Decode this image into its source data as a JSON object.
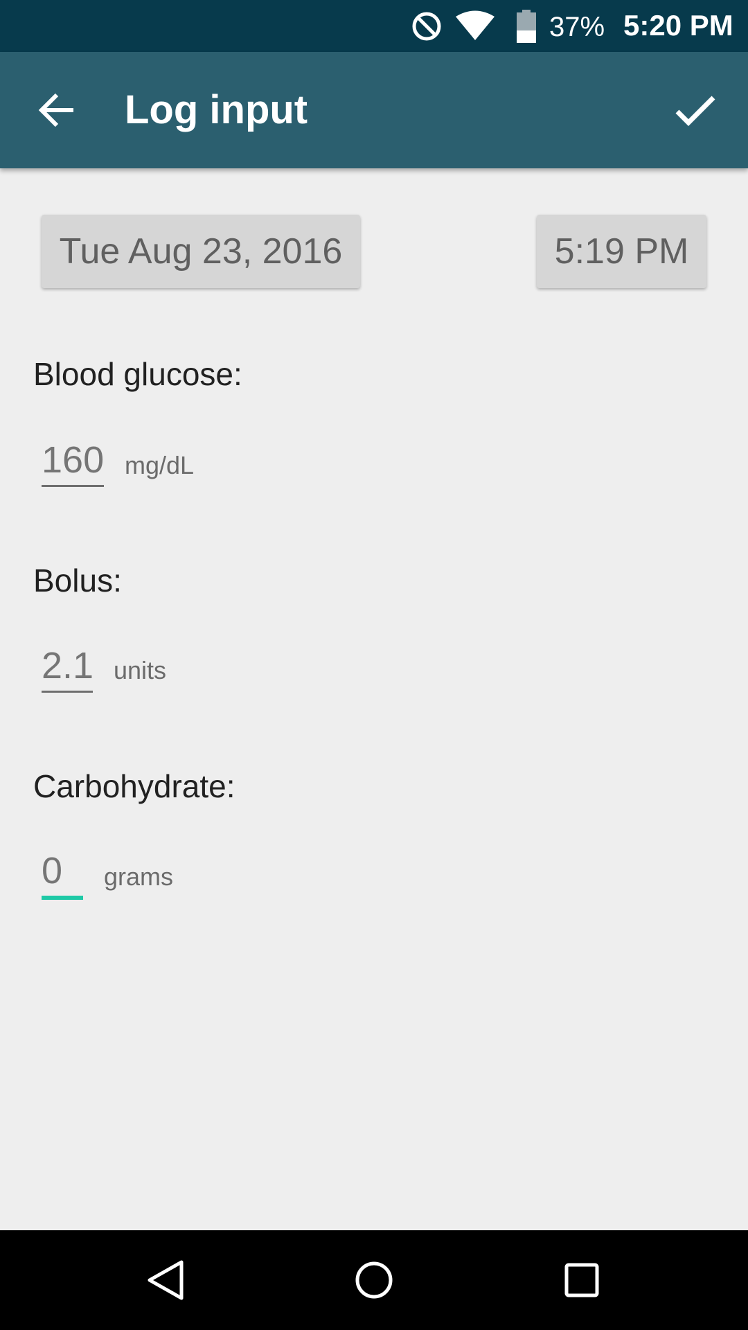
{
  "status_bar": {
    "battery_percent": "37%",
    "time": "5:20 PM",
    "icons": [
      "do-not-disturb-icon",
      "wifi-icon",
      "battery-icon"
    ]
  },
  "app_bar": {
    "title": "Log input",
    "back_icon": "arrow-back-icon",
    "confirm_icon": "checkmark-icon",
    "background_color": "#2b5f6f"
  },
  "datetime": {
    "date": "Tue Aug 23, 2016",
    "time": "5:19 PM"
  },
  "fields": {
    "blood_glucose": {
      "label": "Blood glucose:",
      "value": "160",
      "unit": "mg/dL"
    },
    "bolus": {
      "label": "Bolus:",
      "value": "2.1",
      "unit": "units"
    },
    "carbohydrate": {
      "label": "Carbohydrate:",
      "value": "0",
      "unit": "grams",
      "focused": true
    }
  },
  "colors": {
    "status_bar": "#073a4c",
    "focus_accent": "#1ec9a6",
    "background": "#eeeeee"
  },
  "nav_bar": {
    "buttons": [
      "back-triangle-icon",
      "home-circle-icon",
      "recents-square-icon"
    ]
  }
}
